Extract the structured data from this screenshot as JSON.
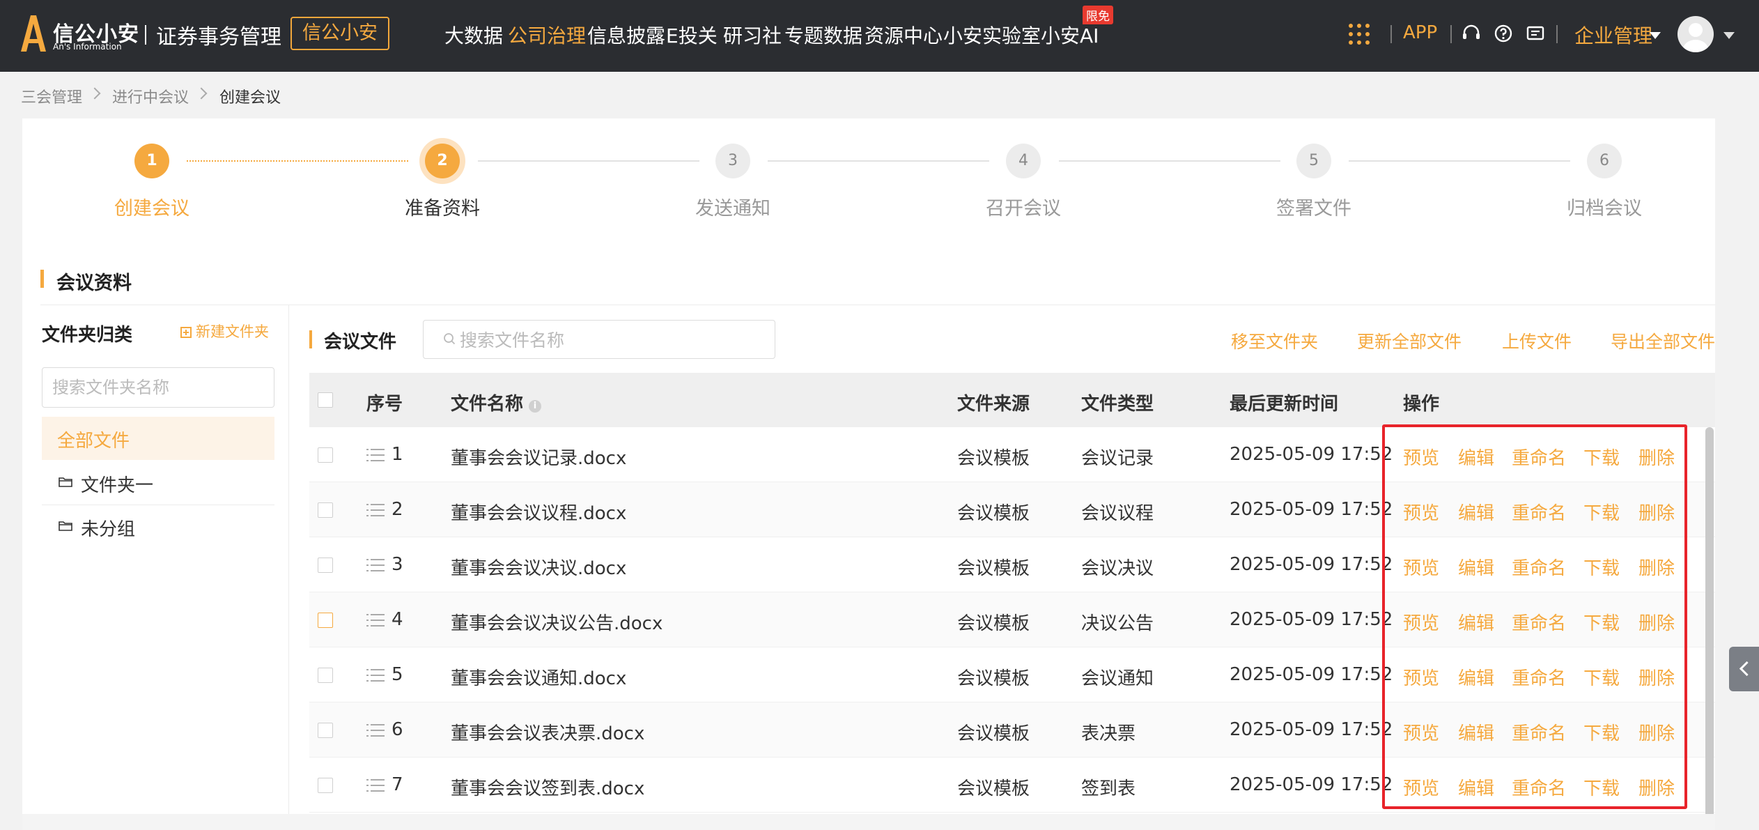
{
  "header": {
    "logo_cn": "信公小安",
    "logo_en": "An's Information",
    "app_name": "证券事务管理",
    "brand_button": "信公小安",
    "nav": [
      {
        "label": "大数据",
        "active": false
      },
      {
        "label": "公司治理",
        "active": true
      },
      {
        "label": "信息披露",
        "active": false
      },
      {
        "label": "E投关",
        "active": false
      },
      {
        "label": "研习社",
        "active": false
      },
      {
        "label": "专题数据",
        "active": false
      },
      {
        "label": "资源中心",
        "active": false
      },
      {
        "label": "小安实验室",
        "active": false
      },
      {
        "label": "小安AI",
        "active": false,
        "badge": "限免"
      }
    ],
    "app_link": "APP",
    "enterprise": "企业管理",
    "accent_color": "#f5a93f"
  },
  "breadcrumb": [
    "三会管理",
    "进行中会议",
    "创建会议"
  ],
  "steps": [
    {
      "num": "1",
      "label": "创建会议",
      "state": "done"
    },
    {
      "num": "2",
      "label": "准备资料",
      "state": "current"
    },
    {
      "num": "3",
      "label": "发送通知",
      "state": "todo"
    },
    {
      "num": "4",
      "label": "召开会议",
      "state": "todo"
    },
    {
      "num": "5",
      "label": "签署文件",
      "state": "todo"
    },
    {
      "num": "6",
      "label": "归档会议",
      "state": "todo"
    }
  ],
  "section_title": "会议资料",
  "folders": {
    "title": "文件夹归类",
    "new_label": "新建文件夹",
    "search_placeholder": "搜索文件夹名称",
    "all_label": "全部文件",
    "items": [
      "文件夹一",
      "未分组"
    ]
  },
  "files": {
    "title": "会议文件",
    "search_placeholder": "搜索文件名称",
    "actions": [
      "移至文件夹",
      "更新全部文件",
      "上传文件",
      "导出全部文件"
    ],
    "columns": {
      "index": "序号",
      "name": "文件名称",
      "source": "文件来源",
      "type": "文件类型",
      "updated": "最后更新时间",
      "ops": "操作"
    },
    "row_ops": [
      "预览",
      "编辑",
      "重命名",
      "下载",
      "删除"
    ],
    "rows": [
      {
        "index": "1",
        "name": "董事会会议记录.docx",
        "source": "会议模板",
        "type": "会议记录",
        "updated": "2025-05-09 17:52"
      },
      {
        "index": "2",
        "name": "董事会会议议程.docx",
        "source": "会议模板",
        "type": "会议议程",
        "updated": "2025-05-09 17:52"
      },
      {
        "index": "3",
        "name": "董事会会议决议.docx",
        "source": "会议模板",
        "type": "会议决议",
        "updated": "2025-05-09 17:52"
      },
      {
        "index": "4",
        "name": "董事会会议决议公告.docx",
        "source": "会议模板",
        "type": "决议公告",
        "updated": "2025-05-09 17:52"
      },
      {
        "index": "5",
        "name": "董事会会议通知.docx",
        "source": "会议模板",
        "type": "会议通知",
        "updated": "2025-05-09 17:52"
      },
      {
        "index": "6",
        "name": "董事会会议表决票.docx",
        "source": "会议模板",
        "type": "表决票",
        "updated": "2025-05-09 17:52"
      },
      {
        "index": "7",
        "name": "董事会会议签到表.docx",
        "source": "会议模板",
        "type": "签到表",
        "updated": "2025-05-09 17:52"
      }
    ]
  }
}
